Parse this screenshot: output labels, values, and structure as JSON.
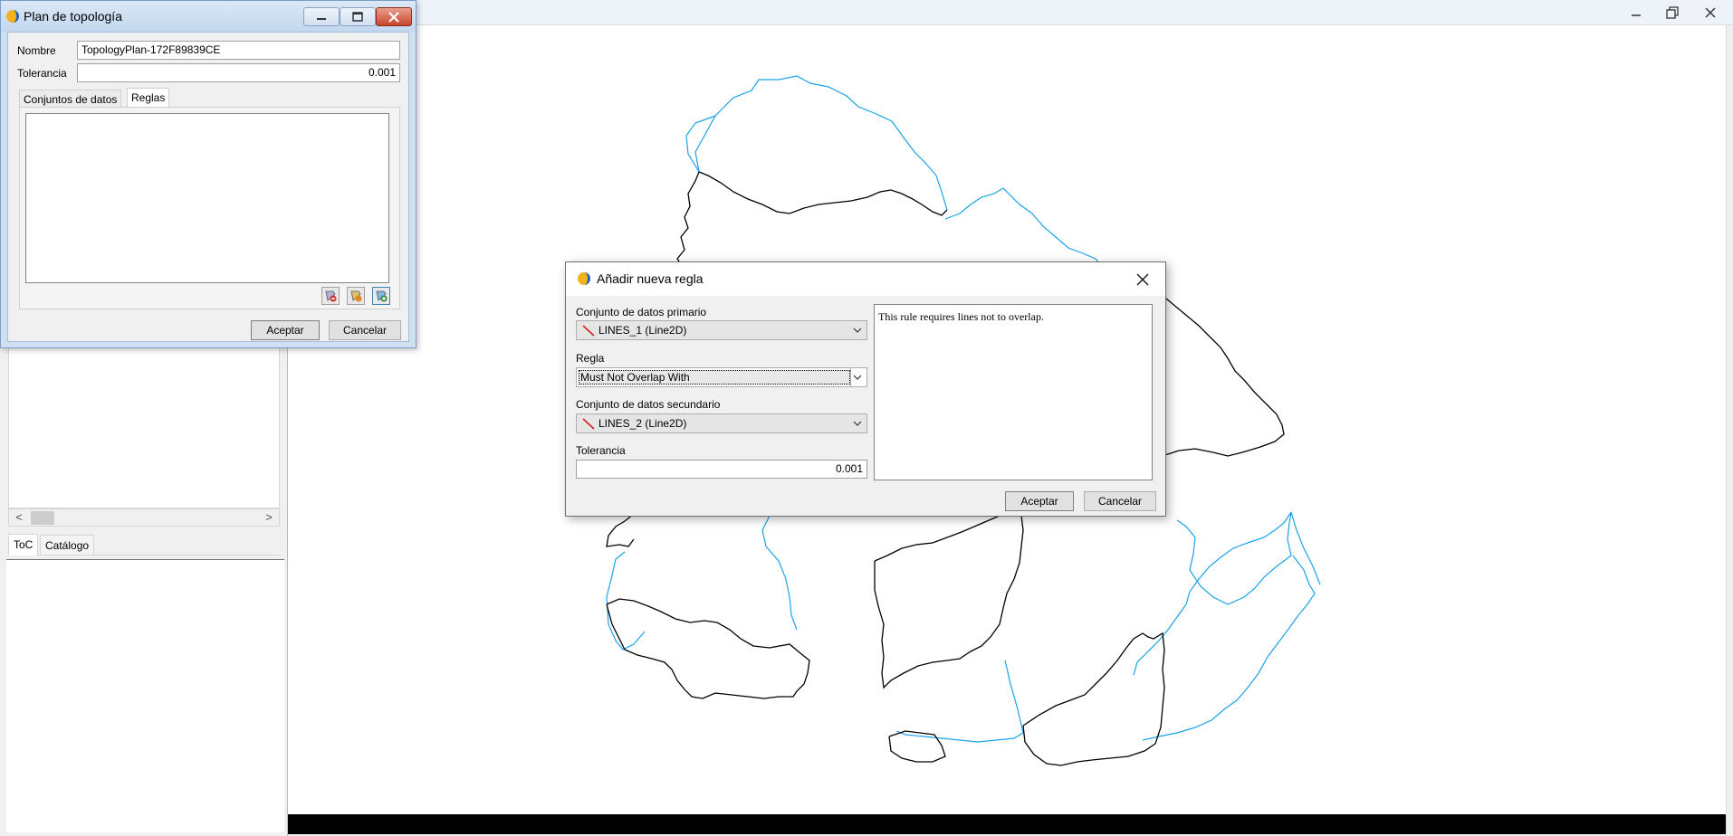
{
  "app": {
    "minimize_label": "minimize",
    "restore_label": "restore",
    "close_label": "close"
  },
  "left_panel": {
    "scroll_left": "<",
    "scroll_right": ">",
    "tabs": [
      {
        "label": "ToC",
        "active": true
      },
      {
        "label": "Catálogo",
        "active": false
      }
    ]
  },
  "plan_dialog": {
    "title": "Plan de topología",
    "name_label": "Nombre",
    "name_value": "TopologyPlan-172F89839CE",
    "tolerance_label": "Tolerancia",
    "tolerance_value": "0.001",
    "tabs": [
      {
        "label": "Conjuntos de datos",
        "active": false
      },
      {
        "label": "Reglas",
        "active": true
      }
    ],
    "tool_icons": [
      "remove-rule-icon",
      "edit-rule-icon",
      "add-rule-icon"
    ],
    "accept_label": "Aceptar",
    "cancel_label": "Cancelar"
  },
  "rule_dialog": {
    "title": "Añadir nueva regla",
    "primary_label": "Conjunto de datos primario",
    "primary_value": "LINES_1 (Line2D)",
    "rule_label": "Regla",
    "rule_value": "Must Not Overlap With",
    "secondary_label": "Conjunto de datos secundario",
    "secondary_value": "LINES_2 (Line2D)",
    "tolerance_label": "Tolerancia",
    "tolerance_value": "0.001",
    "description": "This rule requires lines not to overlap.",
    "accept_label": "Aceptar",
    "cancel_label": "Cancelar"
  },
  "colors": {
    "layer_lines_1": "#000000",
    "layer_lines_2": "#1aa3e8",
    "dataset_glyph": "#d42020"
  }
}
